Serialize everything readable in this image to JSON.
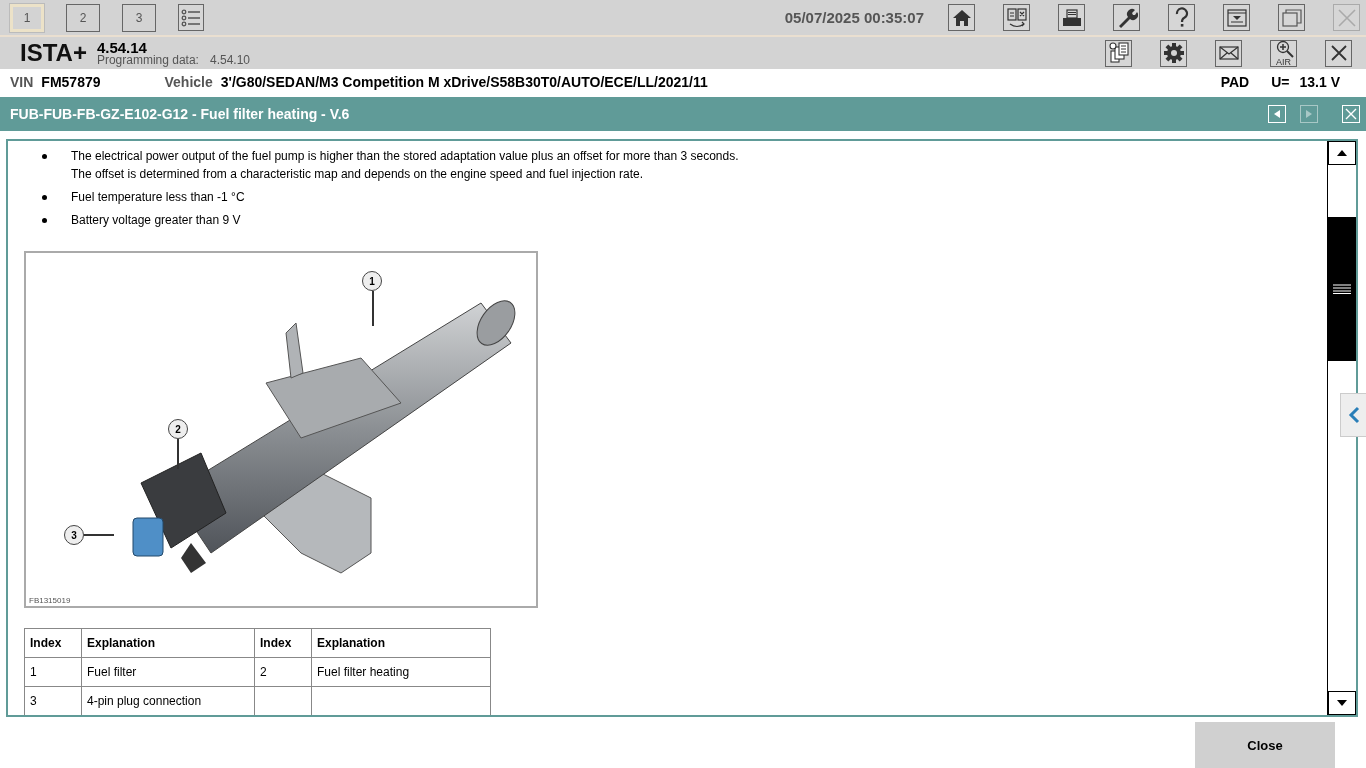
{
  "workspace_tabs": [
    {
      "label": "1",
      "selected": true
    },
    {
      "label": "2",
      "selected": false
    },
    {
      "label": "3",
      "selected": false
    }
  ],
  "datetime": "05/07/2025 00:35:07",
  "toolbar_top": [
    {
      "kind": "home",
      "disabled": false
    },
    {
      "kind": "swap",
      "disabled": false
    },
    {
      "kind": "print",
      "disabled": false
    },
    {
      "kind": "wrench",
      "disabled": false
    },
    {
      "kind": "help",
      "disabled": false
    },
    {
      "kind": "download",
      "disabled": false
    },
    {
      "kind": "windows",
      "disabled": false
    },
    {
      "kind": "close",
      "disabled": true
    }
  ],
  "app": {
    "name": "ISTA+",
    "version": "4.54.14",
    "programming_label": "Programming data:",
    "programming_version": "4.54.10"
  },
  "toolbar_second": [
    {
      "kind": "documents"
    },
    {
      "kind": "gear"
    },
    {
      "kind": "mail"
    },
    {
      "kind": "air",
      "label": "AIR"
    },
    {
      "kind": "close"
    }
  ],
  "vehicle_bar": {
    "vin_label": "VIN",
    "vin": "FM57879",
    "vehicle_label": "Vehicle",
    "vehicle": "3'/G80/SEDAN/M3 Competition M xDrive/S58B30T0/AUTO/ECE/LL/2021/11",
    "pad": "PAD",
    "voltage_label": "U=",
    "voltage": "13.1 V"
  },
  "document": {
    "title": "FUB-FUB-FB-GZ-E102-G12 - Fuel filter heating - V.6",
    "back_disabled": false,
    "forward_disabled": true,
    "bullets": [
      {
        "lines": [
          "The electrical power output of the fuel pump is higher than the stored adaptation value plus an offset for more than 3 seconds.",
          "The offset is determined from a characteristic map and depends on the engine speed and fuel injection rate."
        ]
      },
      {
        "lines": [
          "Fuel temperature less than -1 °C"
        ]
      },
      {
        "lines": [
          "Battery voltage greater than 9 V"
        ]
      }
    ],
    "figure": {
      "callouts": [
        "1",
        "2",
        "3"
      ],
      "code": "FB1315019"
    },
    "table": {
      "columns": [
        "Index",
        "Explanation",
        "Index",
        "Explanation"
      ],
      "rows": [
        [
          "1",
          "Fuel filter",
          "2",
          "Fuel filter heating"
        ],
        [
          "3",
          "4-pin plug connection",
          "",
          ""
        ]
      ]
    }
  },
  "close_button": "Close"
}
